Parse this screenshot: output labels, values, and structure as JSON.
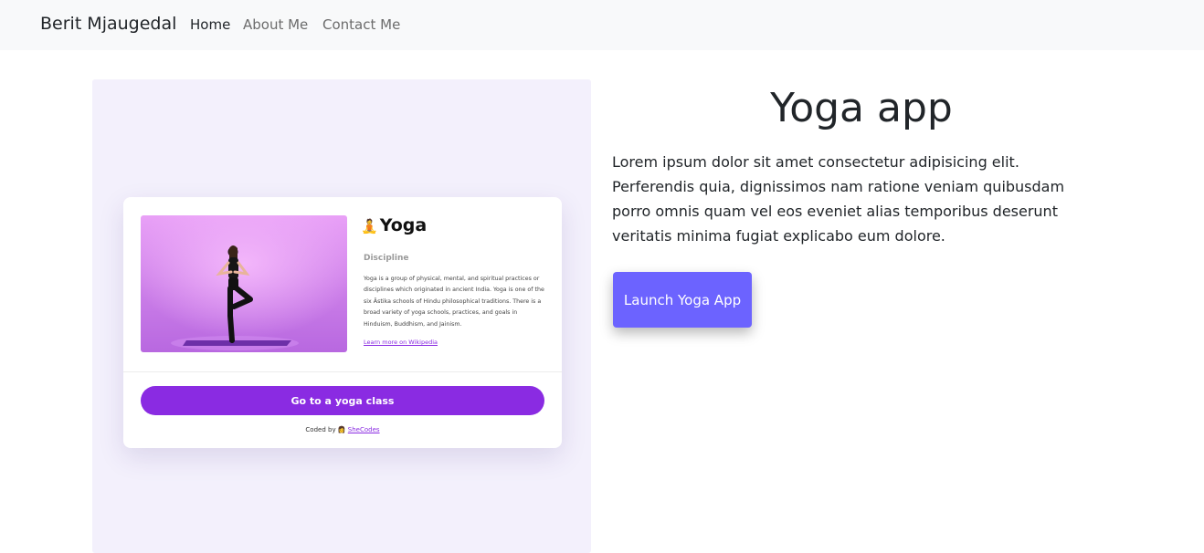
{
  "nav": {
    "brand": "Berit Mjaugedal",
    "links": [
      {
        "label": "Home",
        "active": true
      },
      {
        "label": "About Me",
        "active": false
      },
      {
        "label": "Contact Me",
        "active": false
      }
    ]
  },
  "preview_card": {
    "image_icon": "yoga-pose-photo",
    "title_emoji": "🧘",
    "title": "Yoga",
    "subtitle": "Discipline",
    "text": "Yoga is a group of physical, mental, and spiritual practices or disciplines which originated in ancient India. Yoga is one of the six Āstika schools of Hindu philosophical traditions. There is a broad variety of yoga schools, practices, and goals in Hinduism, Buddhism, and Jainism.",
    "link": "Learn more on Wikipedia",
    "button": "Go to a yoga class",
    "footer_prefix": "Coded by",
    "footer_emoji": "👩",
    "footer_link": "SheCodes"
  },
  "project": {
    "title": "Yoga app",
    "description": "Lorem ipsum dolor sit amet consectetur adipisicing elit. Perferendis quia, dignissimos nam ratione veniam quibusdam porro omnis quam vel eos eveniet alias temporibus deserunt veritatis minima fugiat explicabo eum dolore.",
    "button": "Launch Yoga App"
  },
  "colors": {
    "accent_purple": "#8a2be2",
    "launch_button": "#6c63ff",
    "navbar_bg": "#f8f9fa",
    "preview_bg": "#f3f0fc"
  }
}
